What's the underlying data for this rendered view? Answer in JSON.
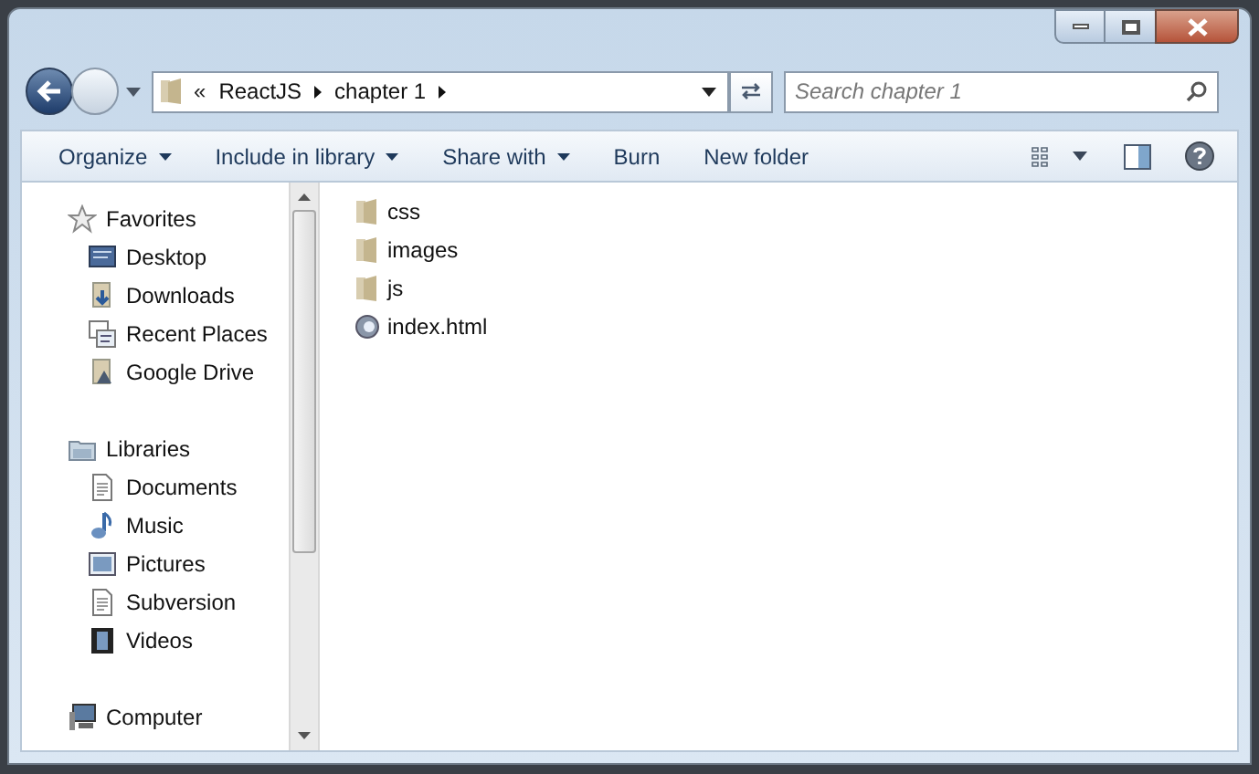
{
  "address_bar": {
    "overflow_marker": "«",
    "crumbs": [
      "ReactJS",
      "chapter 1"
    ]
  },
  "search": {
    "placeholder": "Search chapter 1"
  },
  "toolbar": {
    "buttons": [
      {
        "label": "Organize",
        "dropdown": true
      },
      {
        "label": "Include in library",
        "dropdown": true
      },
      {
        "label": "Share with",
        "dropdown": true
      },
      {
        "label": "Burn",
        "dropdown": false
      },
      {
        "label": "New folder",
        "dropdown": false
      }
    ]
  },
  "nav_pane": {
    "groups": [
      {
        "label": "Favorites",
        "kind": "star",
        "children": [
          {
            "label": "Desktop",
            "kind": "desktop"
          },
          {
            "label": "Downloads",
            "kind": "downloads"
          },
          {
            "label": "Recent Places",
            "kind": "recent"
          },
          {
            "label": "Google Drive",
            "kind": "drive"
          }
        ]
      },
      {
        "label": "Libraries",
        "kind": "libraries",
        "children": [
          {
            "label": "Documents",
            "kind": "documents"
          },
          {
            "label": "Music",
            "kind": "music"
          },
          {
            "label": "Pictures",
            "kind": "pictures"
          },
          {
            "label": "Subversion",
            "kind": "documents"
          },
          {
            "label": "Videos",
            "kind": "videos"
          }
        ]
      },
      {
        "label": "Computer",
        "kind": "computer"
      }
    ]
  },
  "files": [
    {
      "name": "css",
      "kind": "folder"
    },
    {
      "name": "images",
      "kind": "folder"
    },
    {
      "name": "js",
      "kind": "folder"
    },
    {
      "name": "index.html",
      "kind": "html"
    }
  ]
}
